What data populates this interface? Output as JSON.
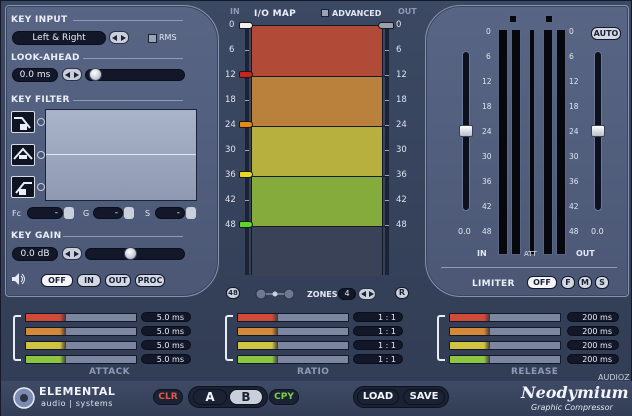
{
  "key_input": {
    "title": "KEY INPUT",
    "source_value": "Left & Right",
    "rms_label": "RMS"
  },
  "look_ahead": {
    "title": "LOOK-AHEAD",
    "value": "0.0 ms"
  },
  "key_filter": {
    "title": "KEY FILTER",
    "fc_label": "Fc",
    "g_label": "G",
    "s_label": "S",
    "fc_value": "-",
    "g_value": "-",
    "s_value": "-"
  },
  "key_gain": {
    "title": "KEY GAIN",
    "value": "0.0 dB",
    "slider_level_fraction": 0.45
  },
  "monitor": {
    "buttons": [
      "OFF",
      "IN",
      "OUT",
      "PROC"
    ],
    "active": "OFF"
  },
  "io_map": {
    "title": "I/O MAP",
    "in_label": "IN",
    "out_label": "OUT",
    "advanced_label": "ADVANCED",
    "ticks": [
      "0",
      "6",
      "12",
      "18",
      "24",
      "30",
      "36",
      "42",
      "48"
    ],
    "zones_label": "ZONES",
    "zones_value": "4",
    "ruler_left_button": "48",
    "ruler_right_button": "R",
    "zone_colors": [
      "#b14a37",
      "#b9813b",
      "#b8b03e",
      "#86ab3d",
      "#3a4258"
    ],
    "marker_colors": [
      "#f2f2f2",
      "#c8261c",
      "#e48a18",
      "#e8d828",
      "#5bd62a"
    ]
  },
  "rows": {
    "colors": [
      "#d04a3a",
      "#d38a38",
      "#d0c440",
      "#8ec642"
    ],
    "attack_values": [
      "5.0 ms",
      "5.0 ms",
      "5.0 ms",
      "5.0 ms"
    ],
    "ratio_values": [
      "1 : 1",
      "1 : 1",
      "1 : 1",
      "1 : 1"
    ],
    "release_values": [
      "200 ms",
      "200 ms",
      "200 ms",
      "200 ms"
    ],
    "attack_label": "ATTACK",
    "ratio_label": "RATIO",
    "release_label": "RELEASE"
  },
  "meters": {
    "ticks": [
      "0",
      "6",
      "12",
      "18",
      "24",
      "30",
      "36",
      "42",
      "48"
    ],
    "in_label": "IN",
    "att_label": "ATT",
    "out_label": "OUT",
    "in_value": "0.0",
    "out_value": "0.0",
    "auto_label": "AUTO"
  },
  "limiter": {
    "label": "LIMITER",
    "buttons": [
      "OFF",
      "F",
      "M",
      "S"
    ],
    "active": "OFF"
  },
  "footer": {
    "brand_line1": "ELEMENTAL",
    "brand_line2": "audio | systems",
    "clr": "CLR",
    "a": "A",
    "b": "B",
    "cpy": "CPY",
    "load": "LOAD",
    "save": "SAVE",
    "product": "Neodymium",
    "subtitle": "Graphic Compressor",
    "watermark": "AUDIOZ"
  }
}
